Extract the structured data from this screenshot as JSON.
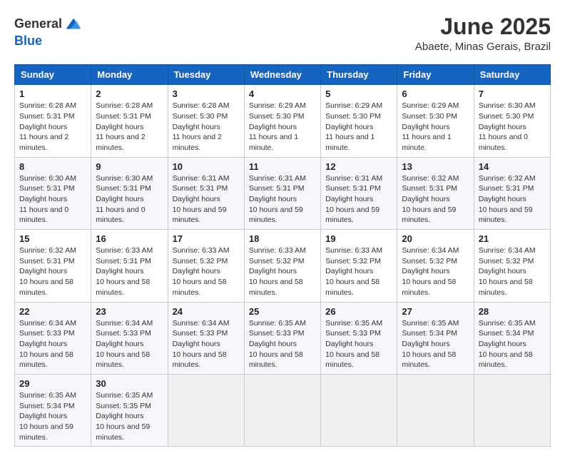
{
  "header": {
    "logo_text_general": "General",
    "logo_text_blue": "Blue",
    "month_title": "June 2025",
    "location": "Abaete, Minas Gerais, Brazil"
  },
  "calendar": {
    "days_of_week": [
      "Sunday",
      "Monday",
      "Tuesday",
      "Wednesday",
      "Thursday",
      "Friday",
      "Saturday"
    ],
    "weeks": [
      [
        {
          "day": "1",
          "sunrise": "6:28 AM",
          "sunset": "5:31 PM",
          "daylight": "11 hours and 2 minutes."
        },
        {
          "day": "2",
          "sunrise": "6:28 AM",
          "sunset": "5:31 PM",
          "daylight": "11 hours and 2 minutes."
        },
        {
          "day": "3",
          "sunrise": "6:28 AM",
          "sunset": "5:30 PM",
          "daylight": "11 hours and 2 minutes."
        },
        {
          "day": "4",
          "sunrise": "6:29 AM",
          "sunset": "5:30 PM",
          "daylight": "11 hours and 1 minute."
        },
        {
          "day": "5",
          "sunrise": "6:29 AM",
          "sunset": "5:30 PM",
          "daylight": "11 hours and 1 minute."
        },
        {
          "day": "6",
          "sunrise": "6:29 AM",
          "sunset": "5:30 PM",
          "daylight": "11 hours and 1 minute."
        },
        {
          "day": "7",
          "sunrise": "6:30 AM",
          "sunset": "5:30 PM",
          "daylight": "11 hours and 0 minutes."
        }
      ],
      [
        {
          "day": "8",
          "sunrise": "6:30 AM",
          "sunset": "5:31 PM",
          "daylight": "11 hours and 0 minutes."
        },
        {
          "day": "9",
          "sunrise": "6:30 AM",
          "sunset": "5:31 PM",
          "daylight": "11 hours and 0 minutes."
        },
        {
          "day": "10",
          "sunrise": "6:31 AM",
          "sunset": "5:31 PM",
          "daylight": "10 hours and 59 minutes."
        },
        {
          "day": "11",
          "sunrise": "6:31 AM",
          "sunset": "5:31 PM",
          "daylight": "10 hours and 59 minutes."
        },
        {
          "day": "12",
          "sunrise": "6:31 AM",
          "sunset": "5:31 PM",
          "daylight": "10 hours and 59 minutes."
        },
        {
          "day": "13",
          "sunrise": "6:32 AM",
          "sunset": "5:31 PM",
          "daylight": "10 hours and 59 minutes."
        },
        {
          "day": "14",
          "sunrise": "6:32 AM",
          "sunset": "5:31 PM",
          "daylight": "10 hours and 59 minutes."
        }
      ],
      [
        {
          "day": "15",
          "sunrise": "6:32 AM",
          "sunset": "5:31 PM",
          "daylight": "10 hours and 58 minutes."
        },
        {
          "day": "16",
          "sunrise": "6:33 AM",
          "sunset": "5:31 PM",
          "daylight": "10 hours and 58 minutes."
        },
        {
          "day": "17",
          "sunrise": "6:33 AM",
          "sunset": "5:32 PM",
          "daylight": "10 hours and 58 minutes."
        },
        {
          "day": "18",
          "sunrise": "6:33 AM",
          "sunset": "5:32 PM",
          "daylight": "10 hours and 58 minutes."
        },
        {
          "day": "19",
          "sunrise": "6:33 AM",
          "sunset": "5:32 PM",
          "daylight": "10 hours and 58 minutes."
        },
        {
          "day": "20",
          "sunrise": "6:34 AM",
          "sunset": "5:32 PM",
          "daylight": "10 hours and 58 minutes."
        },
        {
          "day": "21",
          "sunrise": "6:34 AM",
          "sunset": "5:32 PM",
          "daylight": "10 hours and 58 minutes."
        }
      ],
      [
        {
          "day": "22",
          "sunrise": "6:34 AM",
          "sunset": "5:33 PM",
          "daylight": "10 hours and 58 minutes."
        },
        {
          "day": "23",
          "sunrise": "6:34 AM",
          "sunset": "5:33 PM",
          "daylight": "10 hours and 58 minutes."
        },
        {
          "day": "24",
          "sunrise": "6:34 AM",
          "sunset": "5:33 PM",
          "daylight": "10 hours and 58 minutes."
        },
        {
          "day": "25",
          "sunrise": "6:35 AM",
          "sunset": "5:33 PM",
          "daylight": "10 hours and 58 minutes."
        },
        {
          "day": "26",
          "sunrise": "6:35 AM",
          "sunset": "5:33 PM",
          "daylight": "10 hours and 58 minutes."
        },
        {
          "day": "27",
          "sunrise": "6:35 AM",
          "sunset": "5:34 PM",
          "daylight": "10 hours and 58 minutes."
        },
        {
          "day": "28",
          "sunrise": "6:35 AM",
          "sunset": "5:34 PM",
          "daylight": "10 hours and 58 minutes."
        }
      ],
      [
        {
          "day": "29",
          "sunrise": "6:35 AM",
          "sunset": "5:34 PM",
          "daylight": "10 hours and 59 minutes."
        },
        {
          "day": "30",
          "sunrise": "6:35 AM",
          "sunset": "5:35 PM",
          "daylight": "10 hours and 59 minutes."
        },
        null,
        null,
        null,
        null,
        null
      ]
    ],
    "labels": {
      "sunrise": "Sunrise:",
      "sunset": "Sunset:",
      "daylight": "Daylight hours"
    }
  }
}
